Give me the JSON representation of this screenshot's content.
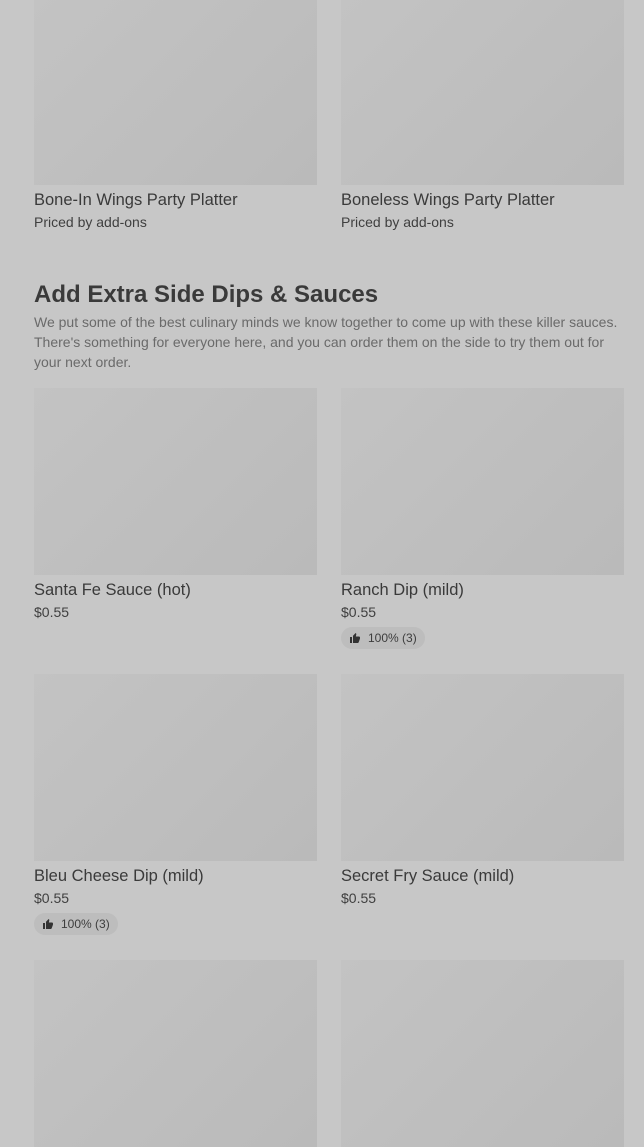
{
  "platters": [
    {
      "name": "Bone-In Wings Party Platter",
      "price": "Priced by add-ons"
    },
    {
      "name": "Boneless Wings Party Platter",
      "price": "Priced by add-ons"
    }
  ],
  "section": {
    "title": "Add Extra Side Dips & Sauces",
    "description": "We put some of the best culinary minds we know together to come up with these killer sauces. There's something for everyone here, and you can order them on the side to try them out for your next order."
  },
  "items": [
    {
      "name": "Santa Fe Sauce (hot)",
      "price": "$0.55"
    },
    {
      "name": "Ranch Dip (mild)",
      "price": "$0.55",
      "rating": "100% (3)"
    },
    {
      "name": "Bleu Cheese Dip (mild)",
      "price": "$0.55",
      "rating": "100% (3)"
    },
    {
      "name": "Secret Fry Sauce (mild)",
      "price": "$0.55"
    }
  ]
}
